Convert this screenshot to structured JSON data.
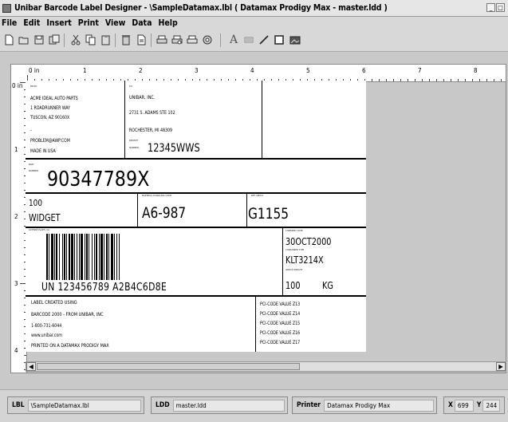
{
  "window": {
    "title": "Unibar Barcode Label Designer - \\SampleDatamax.lbl ( Datamax Prodigy Max - master.ldd )",
    "minimize_glyph": "_",
    "maximize_glyph": "□"
  },
  "menu": [
    "File",
    "Edit",
    "Insert",
    "Print",
    "View",
    "Data",
    "Help"
  ],
  "toolbar": {
    "icons": [
      "new-icon",
      "open-icon",
      "save-icon",
      "save-as-icon",
      "cut-icon",
      "copy-icon",
      "paste-icon",
      "delete-icon",
      "properties-icon",
      "print-icon",
      "print-preview-icon",
      "print-setup-icon",
      "label-setup-icon",
      "text-tool-icon",
      "barcode-tool-icon",
      "line-tool-icon",
      "box-tool-icon",
      "image-tool-icon"
    ],
    "text_tool_glyph": "A"
  },
  "ruler": {
    "top_labels": [
      "0 in",
      "1",
      "2",
      "3",
      "4",
      "5",
      "6",
      "7",
      "8"
    ],
    "left_labels": [
      "0 in",
      "1",
      "2",
      "3",
      "4"
    ]
  },
  "label": {
    "from_header": "FROM:",
    "from_lines": [
      "ACME IDEAL AUTO PARTS",
      "1 ROADRUNNER WAY",
      "TUSCON, AZ 90160X",
      "-",
      "PROBLEM@AWP.COM",
      "MADE IN USA"
    ],
    "to_header": "TO:",
    "to_lines": [
      "UNIBAR, INC.",
      "2731 S. ADAMS STE 102",
      "ROCHESTER, MI 48309"
    ],
    "receipt_header": "RECEIPT",
    "receipt_header2": "NUMBER:",
    "receipt_value": "12345WWS",
    "part_header": "PART",
    "part_header2": "NUMBER:",
    "part_number": "90347789X",
    "qty": "100",
    "description": "WIDGET",
    "material_header": "MATERIAL HANDLING CODE",
    "material_value": "A6-987",
    "ref_header": "REF SPECS:",
    "ref_value": "G1155",
    "barcode_header": "LICENSE PLATE (1J)",
    "barcode_text": "UN 123456789 A2B4C6D8E",
    "ship_header": "SHIPMENT DATE",
    "ship_date": "30OCT2000",
    "container_header": "CONTAINER TYPE",
    "container": "KLT3214X",
    "gross_header": "GROSS WEIGHT",
    "gross_weight": "100",
    "gross_unit": "KG",
    "footer_lines": [
      "LABEL CREATED USING",
      "BARCODE 2000 - FROM UNIBAR, INC",
      "1-800-731-6044",
      "www.unibar.com",
      "PRINTED ON A DATAMAX PRODIGY MAX"
    ],
    "pci_lines": [
      "PCI-CODE VALUE Z13",
      "PCI-CODE VALUE Z14",
      "PCI-CODE VALUE Z15",
      "PCI-CODE VALUE Z16",
      "PCI-CODE VALUE Z17"
    ]
  },
  "scrollbar": {
    "left_glyph": "◀",
    "right_glyph": "▶"
  },
  "status": {
    "lbl_label": "LBL",
    "lbl_value": "\\SampleDatamax.lbl",
    "ldd_label": "LDD",
    "ldd_value": "master.ldd",
    "printer_label": "Printer",
    "printer_value": "Datamax Prodigy Max",
    "x_label": "X",
    "x_value": "699",
    "y_label": "Y",
    "y_value": "244"
  }
}
